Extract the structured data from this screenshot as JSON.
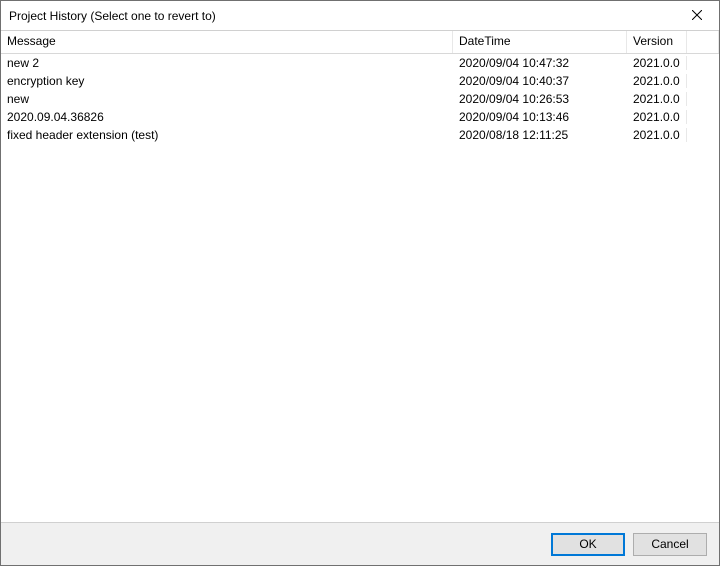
{
  "window": {
    "title": "Project History (Select one to revert to)"
  },
  "columns": {
    "message": "Message",
    "datetime": "DateTime",
    "version": "Version"
  },
  "rows": [
    {
      "message": "new 2",
      "datetime": "2020/09/04 10:47:32",
      "version": "2021.0.0"
    },
    {
      "message": "encryption key",
      "datetime": "2020/09/04 10:40:37",
      "version": "2021.0.0"
    },
    {
      "message": "new",
      "datetime": "2020/09/04 10:26:53",
      "version": "2021.0.0"
    },
    {
      "message": "2020.09.04.36826",
      "datetime": "2020/09/04 10:13:46",
      "version": "2021.0.0"
    },
    {
      "message": "fixed header extension (test)",
      "datetime": "2020/08/18 12:11:25",
      "version": "2021.0.0"
    }
  ],
  "buttons": {
    "ok": "OK",
    "cancel": "Cancel"
  }
}
